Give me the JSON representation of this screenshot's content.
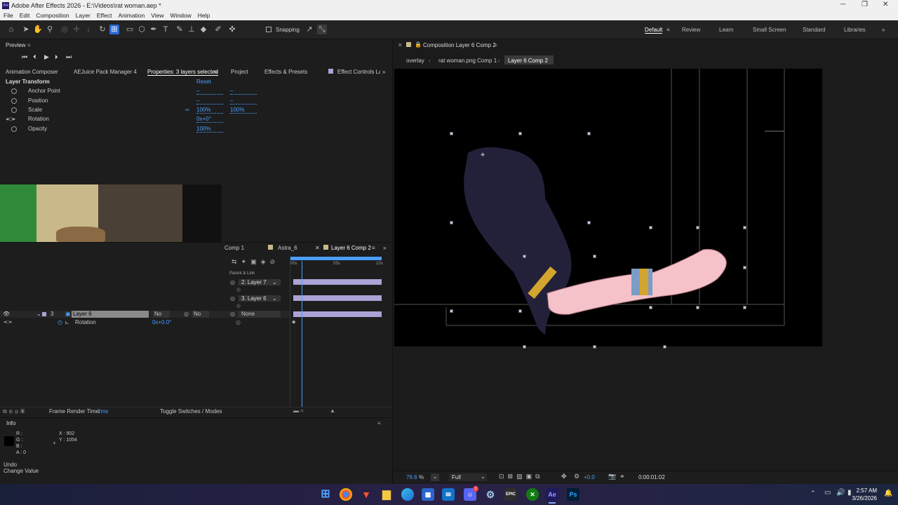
{
  "window": {
    "title": "Adobe After Effects 2026 - E:\\Videos\\rat woman.aep *",
    "logo": "Ae"
  },
  "menu": [
    "File",
    "Edit",
    "Composition",
    "Layer",
    "Effect",
    "Animation",
    "View",
    "Window",
    "Help"
  ],
  "toolbar": {
    "snapping_label": "Snapping"
  },
  "workspaces": [
    "Default",
    "Review",
    "Learn",
    "Small Screen",
    "Standard",
    "Libraries"
  ],
  "preview": {
    "title": "Preview"
  },
  "panel_tabs": [
    "Animation Composer",
    "AEJuice Pack Manager 4",
    "Properties: 3 layers selected",
    "Project",
    "Effects & Presets",
    "Effect Controls Lay"
  ],
  "properties": {
    "section": "Layer Transform",
    "reset": "Reset",
    "rows": [
      {
        "name": "Anchor Point",
        "v1": "–",
        "v2": "–"
      },
      {
        "name": "Position",
        "v1": "–",
        "v2": "–"
      },
      {
        "name": "Scale",
        "v1": "100%",
        "v2": "100%"
      },
      {
        "name": "Rotation",
        "v1": "0x+0°",
        "v2": ""
      },
      {
        "name": "Opacity",
        "v1": "100%",
        "v2": ""
      }
    ]
  },
  "timeline": {
    "tabs": [
      "Comp 1",
      "Astra_6",
      "Layer 6 Comp 2"
    ],
    "ruler": [
      "00s",
      "05s",
      "10s"
    ],
    "parent_header": "Parent & Link",
    "layers": [
      {
        "label": "2. Layer 7"
      },
      {
        "label": "3. Layer 6"
      }
    ],
    "selected_layer": {
      "num": "3",
      "name": "Layer 6",
      "mode": "No",
      "track": "No",
      "parent": "None"
    },
    "rotation_prop": {
      "name": "Rotation",
      "value": "0x+0.0°"
    },
    "footer_render_label": "Frame Render Time:",
    "footer_render_value": "1ms",
    "footer_toggle": "Toggle Switches / Modes"
  },
  "info": {
    "title": "Info",
    "r": "R :",
    "g": "G :",
    "b": "B :",
    "a": "A : 0",
    "x": "X : 902",
    "y": "Y : 1054",
    "undo": "Undo",
    "undo_action": "Change Value"
  },
  "composition": {
    "tab_title": "Composition Layer 6 Comp 2",
    "breadcrumbs": [
      "overlay",
      "rat woman.png Comp 1",
      "Layer 6 Comp 2"
    ],
    "zoom": "76.6",
    "zoom_unit": "%",
    "resolution": "Full",
    "exposure": "+0.0",
    "timecode": "0:00:01:02"
  },
  "taskbar": {
    "time": "2:57 AM",
    "date": "3/26/2026",
    "apps": [
      "windows-start",
      "chrome",
      "brave",
      "file-explorer",
      "edge",
      "ms-store",
      "outlook",
      "discord",
      "steam",
      "epic-games",
      "xbox",
      "after-effects",
      "photoshop"
    ],
    "ae_label": "Ae",
    "ps_label": "Ps",
    "epic_label": "EPIC",
    "discord_badge": "1"
  }
}
